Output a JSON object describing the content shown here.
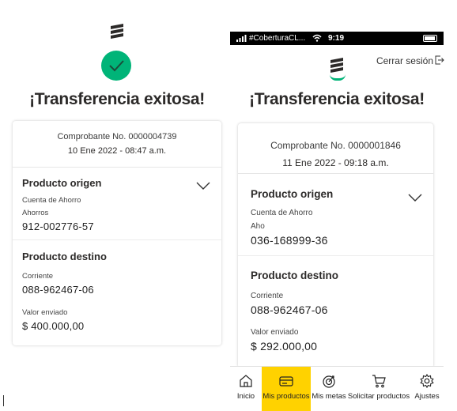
{
  "left": {
    "title": "¡Transferencia exitosa!",
    "receipt": "Comprobante No. 0000004739",
    "datetime": "10 Ene 2022 - 08:47 a.m.",
    "origin": {
      "title": "Producto origen",
      "type": "Cuenta de Ahorro",
      "subtype": "Ahorros",
      "number": "912-002776-57"
    },
    "destination": {
      "title": "Producto destino",
      "type": "Corriente",
      "number": "088-962467-06",
      "amount_label": "Valor enviado",
      "amount": "$ 400.000,00"
    }
  },
  "right": {
    "status": {
      "carrier": "#CoberturaCL...",
      "time": "9:19"
    },
    "logout_label": "Cerrar sesión",
    "title": "¡Transferencia exitosa!",
    "receipt": "Comprobante No. 0000001846",
    "datetime": "11 Ene 2022 - 09:18 a.m.",
    "origin": {
      "title": "Producto origen",
      "type": "Cuenta de Ahorro",
      "subtype": "Aho",
      "number": "036-168999-36"
    },
    "destination": {
      "title": "Producto destino",
      "type": "Corriente",
      "number": "088-962467-06",
      "amount_label": "Valor enviado",
      "amount": "$ 292.000,00"
    },
    "nav": [
      {
        "label": "Inicio",
        "icon": "home-icon"
      },
      {
        "label": "Mis productos",
        "icon": "wallet-icon",
        "active": true
      },
      {
        "label": "Mis metas",
        "icon": "target-icon"
      },
      {
        "label": "Solicitar productos",
        "icon": "cart-icon"
      },
      {
        "label": "Ajustes",
        "icon": "gear-icon"
      }
    ]
  },
  "colors": {
    "success": "#00b478",
    "active_nav": "#ffd200",
    "text": "#2c2a29"
  }
}
